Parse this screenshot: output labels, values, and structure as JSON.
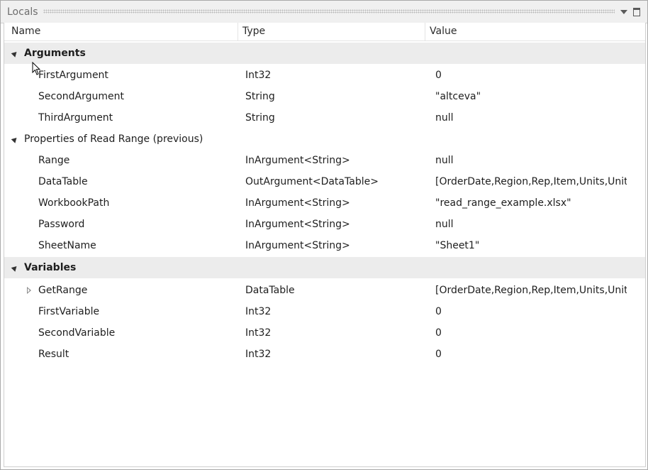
{
  "panel": {
    "title": "Locals"
  },
  "columns": {
    "name": "Name",
    "type": "Type",
    "value": "Value"
  },
  "groups": {
    "arguments": {
      "label": "Arguments",
      "rows": [
        {
          "name": "FirstArgument",
          "type": "Int32",
          "value": "0"
        },
        {
          "name": "SecondArgument",
          "type": "String",
          "value": "\"altceva\""
        },
        {
          "name": "ThirdArgument",
          "type": "String",
          "value": "null"
        }
      ]
    },
    "properties": {
      "label": "Properties of Read Range (previous)",
      "rows": [
        {
          "name": "Range",
          "type": "InArgument<String>",
          "value": "null"
        },
        {
          "name": "DataTable",
          "type": "OutArgument<DataTable>",
          "value": "[OrderDate,Region,Rep,Item,Units,Unit Co"
        },
        {
          "name": "WorkbookPath",
          "type": "InArgument<String>",
          "value": "\"read_range_example.xlsx\""
        },
        {
          "name": "Password",
          "type": "InArgument<String>",
          "value": "null"
        },
        {
          "name": "SheetName",
          "type": "InArgument<String>",
          "value": "\"Sheet1\""
        }
      ]
    },
    "variables": {
      "label": "Variables",
      "rows": [
        {
          "name": "GetRange",
          "type": "DataTable",
          "value": "[OrderDate,Region,Rep,Item,Units,Unit Co"
        },
        {
          "name": "FirstVariable",
          "type": "Int32",
          "value": "0"
        },
        {
          "name": "SecondVariable",
          "type": "Int32",
          "value": "0"
        },
        {
          "name": "Result",
          "type": "Int32",
          "value": "0"
        }
      ]
    }
  }
}
